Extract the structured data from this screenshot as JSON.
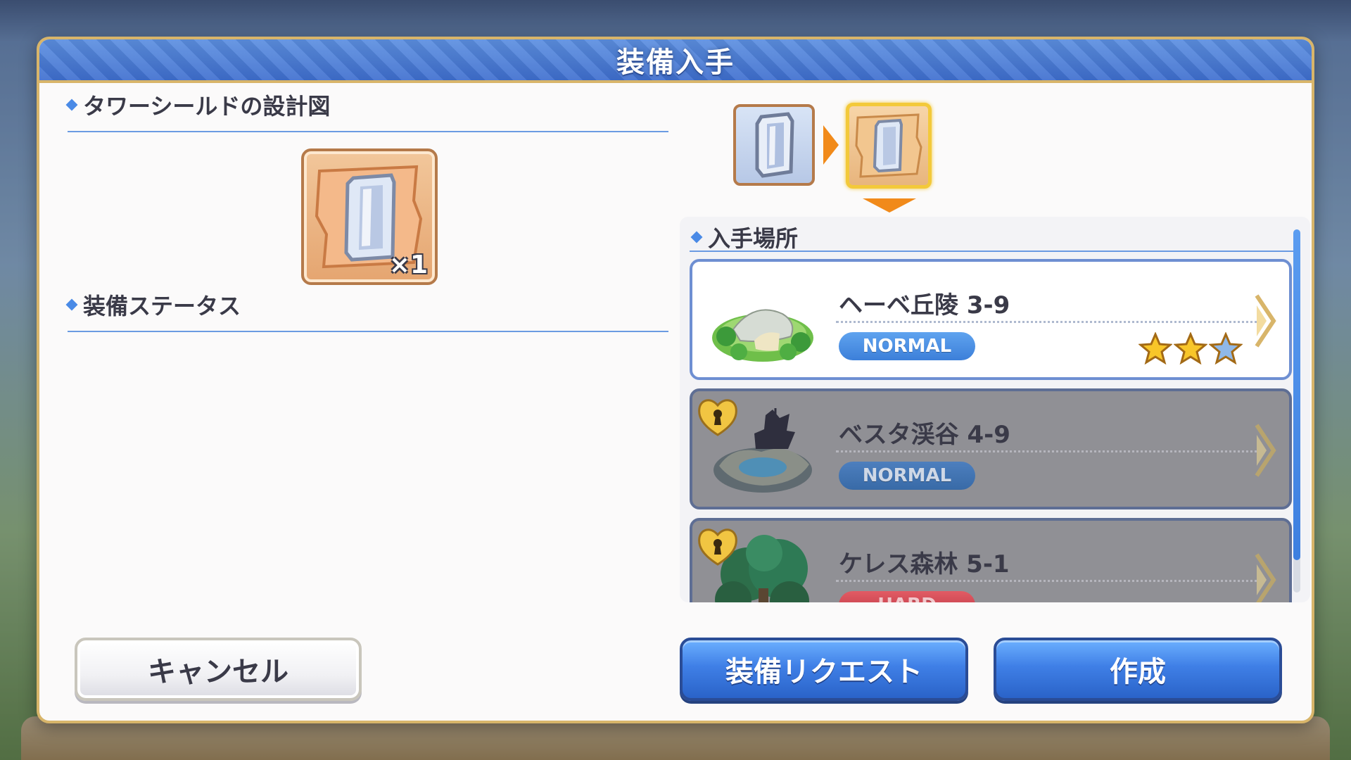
{
  "dialog": {
    "title": "装備入手"
  },
  "left": {
    "item_name": "タワーシールドの設計図",
    "quantity": "×1",
    "status_heading": "装備ステータス"
  },
  "right": {
    "source_heading": "入手場所",
    "stages": [
      {
        "name": "ヘーベ丘陵 3-9",
        "difficulty": "NORMAL",
        "locked": false,
        "stars": 3
      },
      {
        "name": "ベスタ渓谷 4-9",
        "difficulty": "NORMAL",
        "locked": true
      },
      {
        "name": "ケレス森林 5-1",
        "difficulty": "HARD",
        "locked": true
      }
    ]
  },
  "buttons": {
    "cancel": "キャンセル",
    "request": "装備リクエスト",
    "make": "作成"
  },
  "icons": {
    "item": "blueprint-icon",
    "material": "shield-icon",
    "lock": "heart-lock-icon",
    "go": "chevron-right-icon",
    "star": "star-icon"
  },
  "colors": {
    "header_blue": "#3f6fcf",
    "frame_gold": "#d8b56a",
    "normal_badge": "#3c7fd9",
    "hard_badge": "#b93643",
    "arrow_orange": "#f18a1a"
  }
}
